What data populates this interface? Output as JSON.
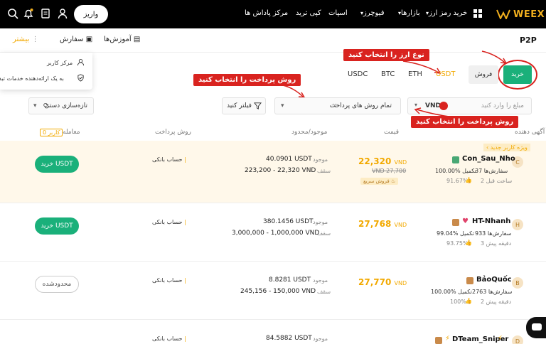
{
  "topnav": {
    "deposit": "واریز",
    "brand": "WEEX",
    "links": [
      "خرید رمز ارز",
      "بازارها",
      "فیوچرز",
      "اسپات",
      "کپی ترید",
      "مرکز پاداش ها"
    ]
  },
  "subnav": {
    "p2p": "P2P",
    "tutorials": "آموزش‌ها",
    "orders": "سفارش",
    "more": "بیشتر"
  },
  "dropdown": {
    "items": [
      "مرکز کاربر",
      "به یک ارائه‌دهنده خدمات تبدیل شوید"
    ]
  },
  "tabs": {
    "buy": "خرید",
    "sell": "فروش"
  },
  "coins": [
    "USDT",
    "ETH",
    "BTC",
    "USDC"
  ],
  "annotations": {
    "coin_type": "نوع ارز را  انتخاب کنید",
    "payment_method": "روش پرداخت را انتخاب کنید",
    "currency": "روش پرداخت را انتخاب کنید"
  },
  "filters": {
    "amount_placeholder": "مبلغ را وارد کنید",
    "currency": "VND",
    "payment_all": "تمام روش های پرداخت",
    "filter_btn": "فیلتر کنید",
    "refresh": "تازه‌سازی دستی"
  },
  "table": {
    "headers": {
      "advertiser": "آگهی دهنده",
      "price": "قیمت",
      "available": "موجود/محدود",
      "payment": "روش پرداخت",
      "trade": "معامله",
      "new_user": "کاربر 0"
    },
    "new_user_tag": "ویژه کاربر جدید",
    "rows": [
      {
        "avatar": "C",
        "name": "Con_Sau_Nho",
        "orders": "37 سفارش‌ها",
        "completion": "100.00% تکمیل",
        "rating": "91.67%",
        "time": "2 ساعت قبل",
        "price": "22,320",
        "unit": "VND",
        "old_price": "VND 27,700",
        "badge": "فروش سریع",
        "avail_label": "موجود",
        "avail": "40.0901 USDT",
        "limit_label": "سقف",
        "limit": "223,200 - 22,320 VND",
        "payment": "حساب بانکی",
        "action": "خرید USDT"
      },
      {
        "avatar": "H",
        "name": "HT-Nhanh",
        "orders": "933 سفارش‌ها",
        "completion": "99.04% تکمیل",
        "rating": "93.75%",
        "time": "3 دقیقه پیش",
        "price": "27,768",
        "unit": "VND",
        "avail_label": "موجود",
        "avail": "380.1456 USDT",
        "limit_label": "سقف",
        "limit": "3,000,000 - 1,000,000 VND",
        "payment": "حساب بانکی",
        "action": "خرید USDT"
      },
      {
        "avatar": "B",
        "name": "BảoQuốc",
        "orders": "2763 سفارش‌ها",
        "completion": "100.00% تکمیل",
        "rating": "100%",
        "time": "2 دقیقه پیش",
        "price": "27,770",
        "unit": "VND",
        "avail_label": "موجود",
        "avail": "8.8281 USDT",
        "limit_label": "سقف",
        "limit": "245,156 - 150,000 VND",
        "payment": "حساب بانکی",
        "action": "محدودشده"
      },
      {
        "avatar": "D",
        "name": "DTeam_Sniper",
        "avail_label": "موجود",
        "avail": "84.5882 USDT",
        "payment": "حساب بانکی"
      }
    ]
  },
  "colors": {
    "accent": "#f2a900",
    "buy": "#1ab07a",
    "annotation": "#d9231f"
  }
}
